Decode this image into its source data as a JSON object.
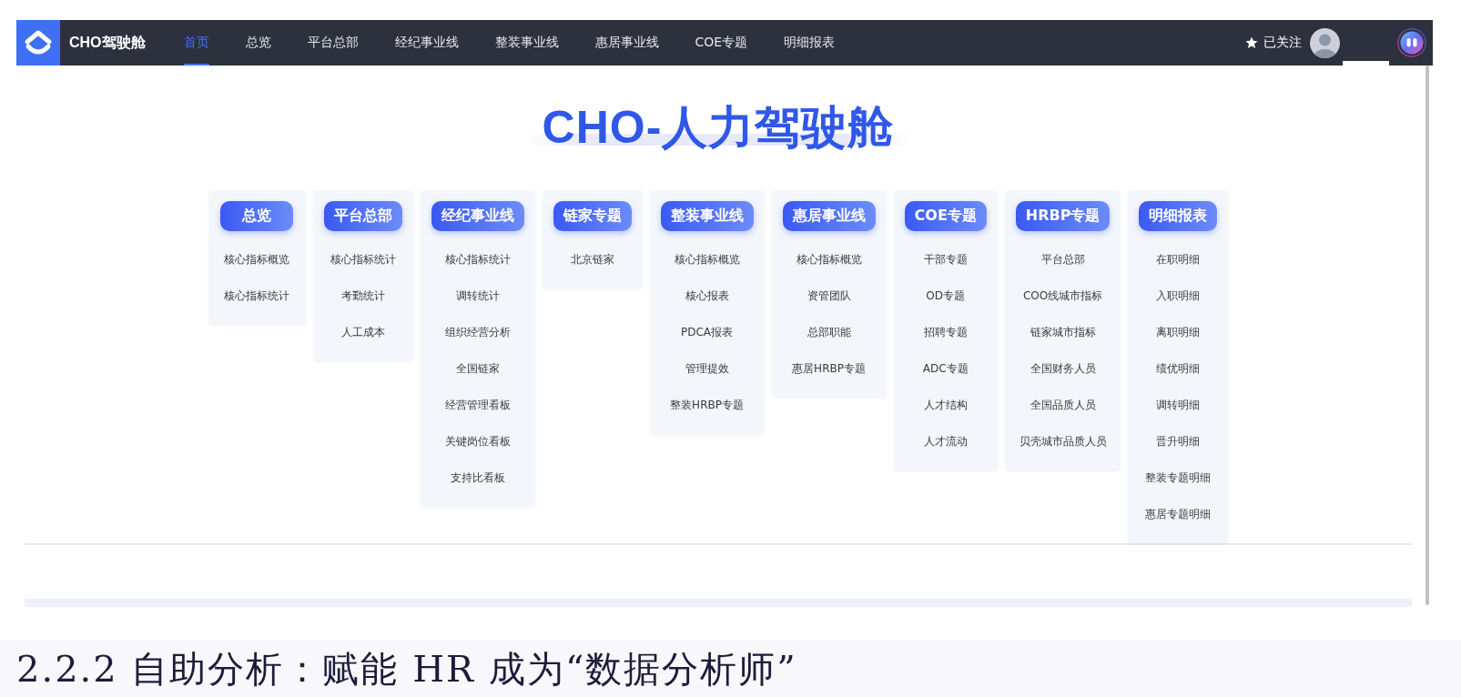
{
  "nav": {
    "brand": "CHO驾驶舱",
    "items": [
      {
        "label": "首页",
        "selected": true
      },
      {
        "label": "总览",
        "selected": false
      },
      {
        "label": "平台总部",
        "selected": false
      },
      {
        "label": "经纪事业线",
        "selected": false
      },
      {
        "label": "整装事业线",
        "selected": false
      },
      {
        "label": "惠居事业线",
        "selected": false
      },
      {
        "label": "COE专题",
        "selected": false
      },
      {
        "label": "明细报表",
        "selected": false
      }
    ],
    "follow": {
      "label": "已关注",
      "followed": true
    }
  },
  "hero": {
    "title": "CHO-人力驾驶舱"
  },
  "menu_columns": [
    {
      "heading": "总览",
      "links": [
        "核心指标概览",
        "核心指标统计"
      ]
    },
    {
      "heading": "平台总部",
      "links": [
        "核心指标统计",
        "考勤统计",
        "人工成本"
      ]
    },
    {
      "heading": "经纪事业线",
      "links": [
        "核心指标统计",
        "调转统计",
        "组织经营分析",
        "全国链家",
        "经营管理看板",
        "关键岗位看板",
        "支持比看板"
      ]
    },
    {
      "heading": "链家专题",
      "links": [
        "北京链家"
      ]
    },
    {
      "heading": "整装事业线",
      "links": [
        "核心指标概览",
        "核心报表",
        "PDCA报表",
        "管理提效",
        "整装HRBP专题"
      ]
    },
    {
      "heading": "惠居事业线",
      "links": [
        "核心指标概览",
        "资管团队",
        "总部职能",
        "惠居HRBP专题"
      ]
    },
    {
      "heading": "COE专题",
      "links": [
        "干部专题",
        "OD专题",
        "招聘专题",
        "ADC专题",
        "人才结构",
        "人才流动"
      ]
    },
    {
      "heading": "HRBP专题",
      "links": [
        "平台总部",
        "COO线城市指标",
        "链家城市指标",
        "全国财务人员",
        "全国品质人员",
        "贝壳城市品质人员"
      ]
    },
    {
      "heading": "明细报表",
      "links": [
        "在职明细",
        "入职明细",
        "离职明细",
        "绩优明细",
        "调转明细",
        "晋升明细",
        "整装专题明细",
        "惠居专题明细"
      ]
    }
  ],
  "document": {
    "heading": "2.2.2 自助分析：赋能 HR 成为“数据分析师”"
  }
}
